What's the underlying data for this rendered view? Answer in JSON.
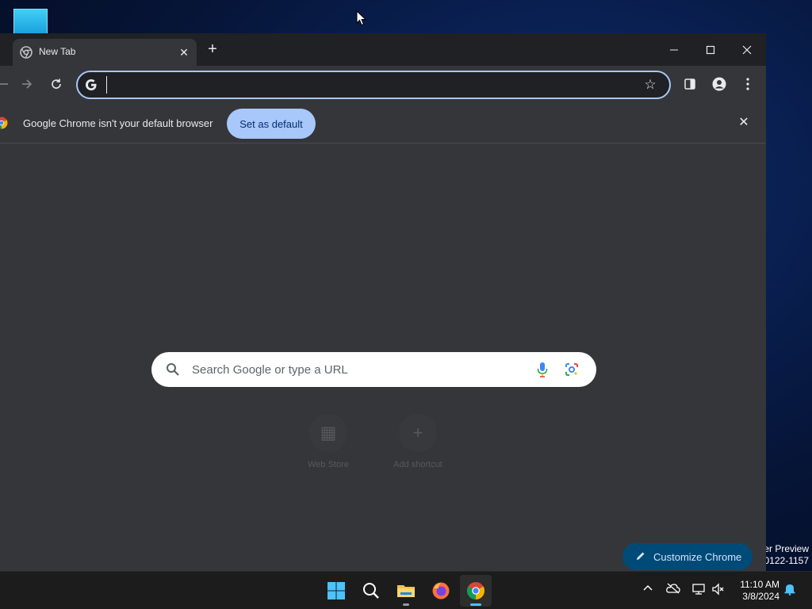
{
  "desktop": {
    "watermark_line1": "er Preview",
    "watermark_line2": "0122-1157"
  },
  "browser": {
    "tab": {
      "title": "New Tab"
    },
    "tab_edge_label": "←",
    "window_controls": {
      "minimize": "—",
      "maximize": "□",
      "close": "✕"
    },
    "omnibox": {
      "value": "",
      "placeholder": ""
    },
    "infobar": {
      "message": "Google Chrome isn't your default browser",
      "button_label": "Set as default"
    },
    "ntp": {
      "search_placeholder": "Search Google or type a URL",
      "shortcuts": [
        {
          "label": "Web Store",
          "icon": "web-store-icon"
        },
        {
          "label": "Add shortcut",
          "icon": "plus-icon"
        }
      ],
      "customize_label": "Customize Chrome"
    }
  },
  "taskbar": {
    "apps": [
      "start",
      "search",
      "file-explorer",
      "firefox",
      "chrome"
    ],
    "clock": {
      "time": "11:10 AM",
      "date": "3/8/2024"
    }
  },
  "colors": {
    "accent": "#a8c7fa",
    "toolbar_bg": "#35363a",
    "tabstrip_bg": "#202124",
    "customize_bg": "#004a77"
  }
}
